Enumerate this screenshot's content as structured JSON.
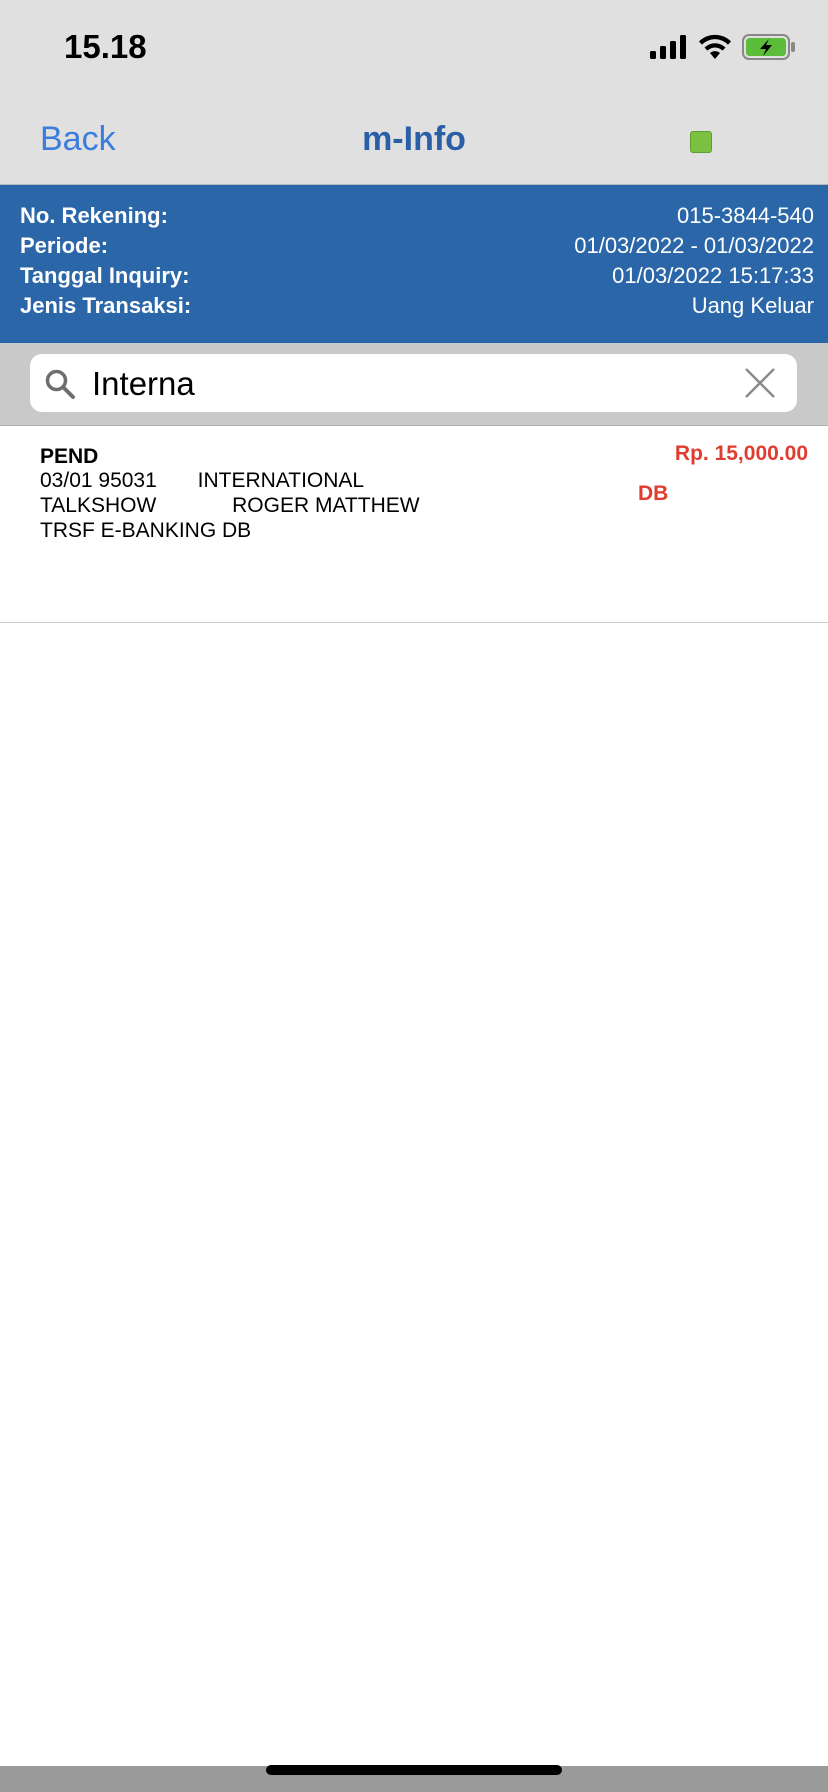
{
  "status_bar": {
    "time": "15.18",
    "icons": [
      "signal-icon",
      "wifi-icon",
      "battery-charging-icon"
    ],
    "battery_color": "#5bbd3a"
  },
  "nav": {
    "back_label": "Back",
    "title": "m-Info",
    "indicator_color": "#7cc242"
  },
  "info": {
    "rows": [
      {
        "label": "No. Rekening:",
        "value": "015-3844-540"
      },
      {
        "label": "Periode:",
        "value": "01/03/2022 - 01/03/2022"
      },
      {
        "label": "Tanggal Inquiry:",
        "value": "01/03/2022 15:17:33"
      },
      {
        "label": "Jenis Transaksi:",
        "value": "Uang Keluar"
      }
    ],
    "background": "#2b67a8"
  },
  "search": {
    "value": "Interna"
  },
  "transactions": [
    {
      "status": "PEND",
      "lines": [
        "03/01 95031       INTERNATIONAL",
        "TALKSHOW             ROGER MATTHEW",
        "TRSF E-BANKING DB"
      ],
      "amount": "Rp.  15,000.00",
      "type": "DB",
      "amount_color": "#e03c2f"
    }
  ]
}
